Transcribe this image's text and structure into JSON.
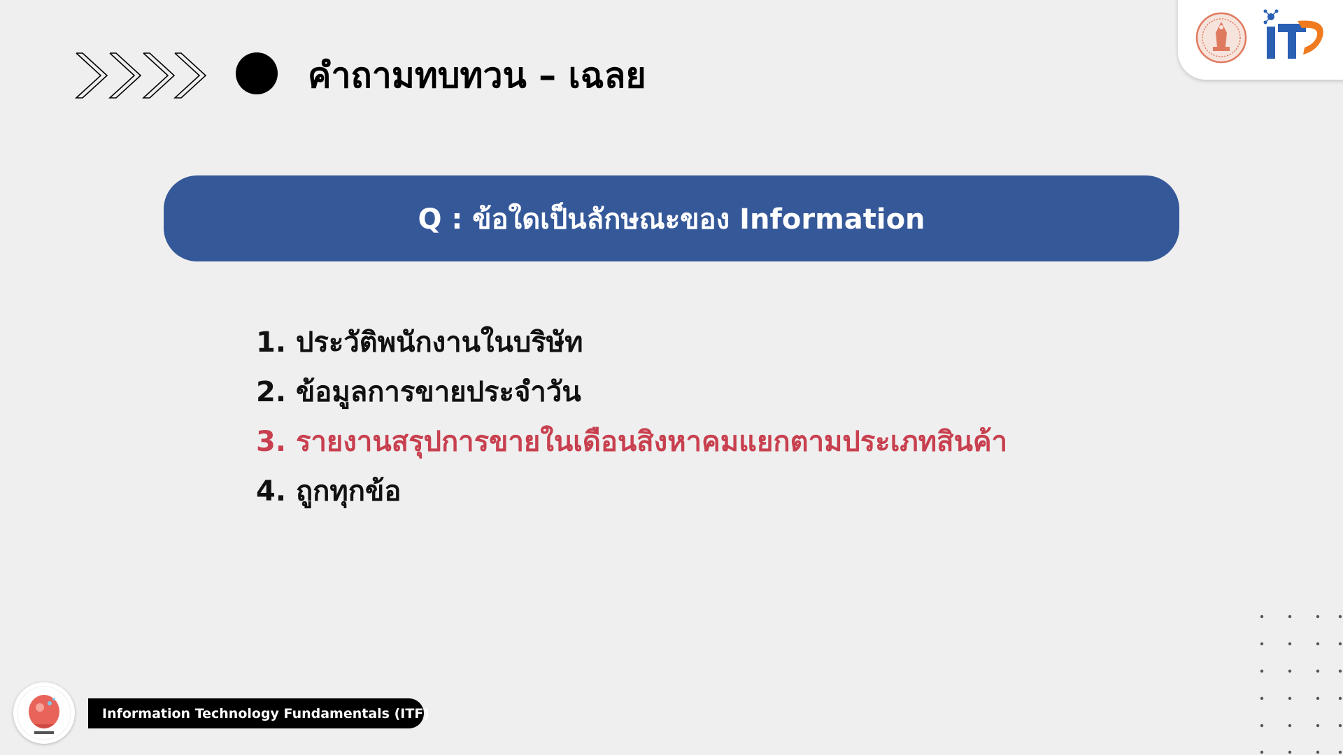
{
  "header": {
    "title": "คำถามทบทวน – เฉลย",
    "chevron_icon": "chevrons-right-icon",
    "bullet_color": "#000000"
  },
  "logos": {
    "seal_icon": "university-seal-icon",
    "it_logo": "it-logo-icon",
    "it_logo_text": "iT"
  },
  "question": {
    "text": "Q :  ข้อใดเป็นลักษณะของ Information",
    "banner_color": "#355899"
  },
  "answers": [
    {
      "text": "1. ประวัติพนักงานในบริษัท",
      "correct": false
    },
    {
      "text": "2. ข้อมูลการขายประจำวัน",
      "correct": false
    },
    {
      "text": "3. รายงานสรุปการขายในเดือนสิงหาคมแยกตามประเภทสินค้า",
      "correct": true
    },
    {
      "text": "4. ถูกทุกข้อ",
      "correct": false
    }
  ],
  "colors": {
    "correct_answer": "#c8404f",
    "normal_answer": "#111111",
    "background": "#efefef"
  },
  "footer": {
    "course_name": "Information Technology Fundamentals (ITF)",
    "mascot_icon": "tobeit-mascot-icon"
  }
}
